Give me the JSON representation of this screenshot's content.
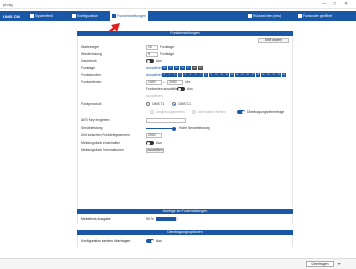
{
  "window": {
    "title": "prolig",
    "controls": [
      "—",
      "□",
      "✕"
    ]
  },
  "navbar": {
    "brand": "UNIS CM",
    "tabs": [
      {
        "label": "Systemfeld",
        "active": false
      },
      {
        "label": "Konfiguration",
        "active": false
      },
      {
        "label": "Funkeinstellungen",
        "active": true
      }
    ],
    "right": [
      "Rückzeichen (neu)",
      "Funkcoder geöffnet"
    ]
  },
  "sections": {
    "main_title": "Funkeinstellungen",
    "reset_label": "Stell ändern",
    "ack_title": "Anzeige an Funkmeldungen",
    "advanced_title": "Übertragungsoptionen"
  },
  "form": {
    "wartezeit": {
      "label": "Wartezeiger",
      "value": "10",
      "unit": "Funktage"
    },
    "wiederholung": {
      "label": "Wiederholung",
      "value": "5",
      "unit": "Funktage"
    },
    "dauerbetrieb": {
      "label": "Dauerfunk",
      "toggle": "off",
      "toggle_label": "Aus"
    },
    "funktage": {
      "label": "Funktage",
      "link": "Auswählen",
      "chips": [
        "Mo",
        "Di",
        "Mi",
        "Do",
        "Fr",
        "Sa",
        "So"
      ]
    },
    "stunden": {
      "label": "Funkstunden",
      "link": "Auswählen",
      "chips": [
        "0",
        "1",
        "2",
        "3",
        "4",
        "5",
        "6",
        "7",
        "8",
        "9",
        "10",
        "11",
        "12",
        "13",
        "14",
        "15",
        "16",
        "17",
        "18",
        "19",
        "20",
        "21",
        "22",
        "23"
      ]
    },
    "funkzeiten": {
      "label": "Funkzeitenen",
      "from": "1400",
      "to": "2000",
      "unit": "Uhr"
    },
    "zeit_toggle": {
      "label": "Funkzeiten auswählen",
      "toggle": "off",
      "toggle_label": "Aus"
    },
    "auswahl_grey": "Auswählen",
    "funkmodul": {
      "label": "Funkprotokoll",
      "options": [
        "OMS T1",
        "OMS C1"
      ],
      "selected": 1
    },
    "radio_grey": [
      "Umgebungswerten",
      "Alternative Werten"
    ],
    "radio_toggle_label": "Übertragungsreihenfolge",
    "aes": {
      "label": "AES Key eingeben"
    },
    "sendeleistung": {
      "label": "Sendeleistung",
      "value_label": "Hohe Sendeleistung"
    },
    "zeitintervall": {
      "label": "Zeit zwischen Funktelegrammen",
      "value": "2000"
    },
    "meldungen": {
      "label": "Meldungsfunk einschalten",
      "toggle": "off",
      "toggle_label": "Aus"
    },
    "schluessel": {
      "label": "Meldungsfunk Informationen",
      "button": "Auswählen"
    },
    "ack": {
      "label": "Meldefunk Ausgabe",
      "value": "90 %",
      "progress": 0.9
    },
    "adv": {
      "label": "Konfiguration senden übertragen",
      "toggle": "on",
      "toggle_label": "Aus"
    }
  },
  "footer": {
    "save": "Übertragen",
    "back": "⇤"
  }
}
